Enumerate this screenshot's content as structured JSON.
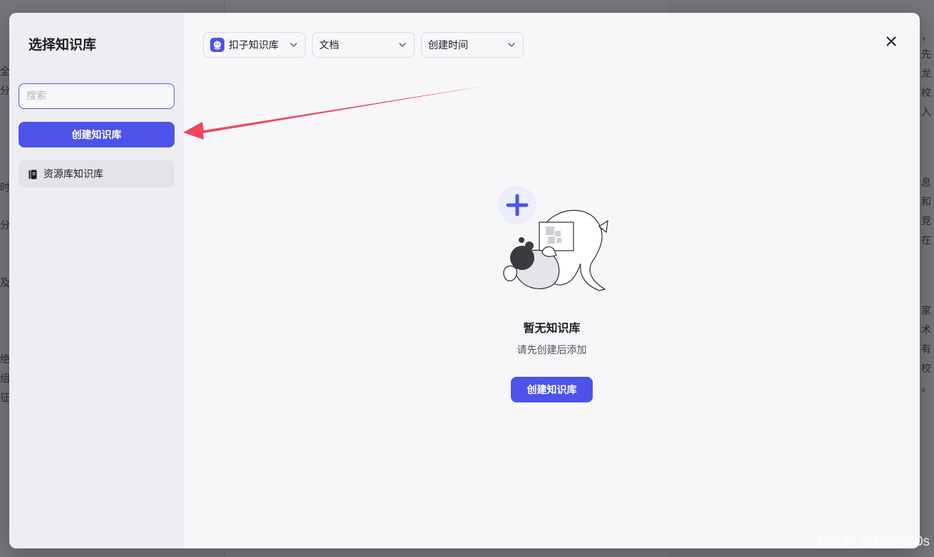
{
  "modal": {
    "title": "选择知识库",
    "close_icon": "close-icon"
  },
  "sidebar": {
    "search_placeholder": "搜索",
    "search_value": "",
    "create_button": "创建知识库",
    "items": [
      {
        "label": "资源库知识库",
        "icon": "book-icon"
      }
    ]
  },
  "filters": [
    {
      "label": "扣子知识库",
      "icon": "coze-logo-icon"
    },
    {
      "label": "文档"
    },
    {
      "label": "创建时间"
    }
  ],
  "empty_state": {
    "title": "暂无知识库",
    "subtitle": "请先创建后添加",
    "button": "创建知识库"
  },
  "background_fragments": {
    "left": [
      "全",
      "分",
      "时",
      "分",
      "及",
      "绝",
      "组",
      "征"
    ],
    "right": [
      "，",
      "先",
      "龙",
      "校",
      "入",
      "息",
      "和",
      "竞",
      "在",
      "家",
      "术",
      "有",
      "校",
      "。"
    ]
  },
  "watermark": "CSDN @Calvad0s",
  "colors": {
    "accent": "#4d53e8",
    "annotation_arrow": "#f0475c",
    "overlay": "#78777c",
    "modal_bg": "#f7f7fa",
    "sidebar_bg": "#edeef1"
  }
}
